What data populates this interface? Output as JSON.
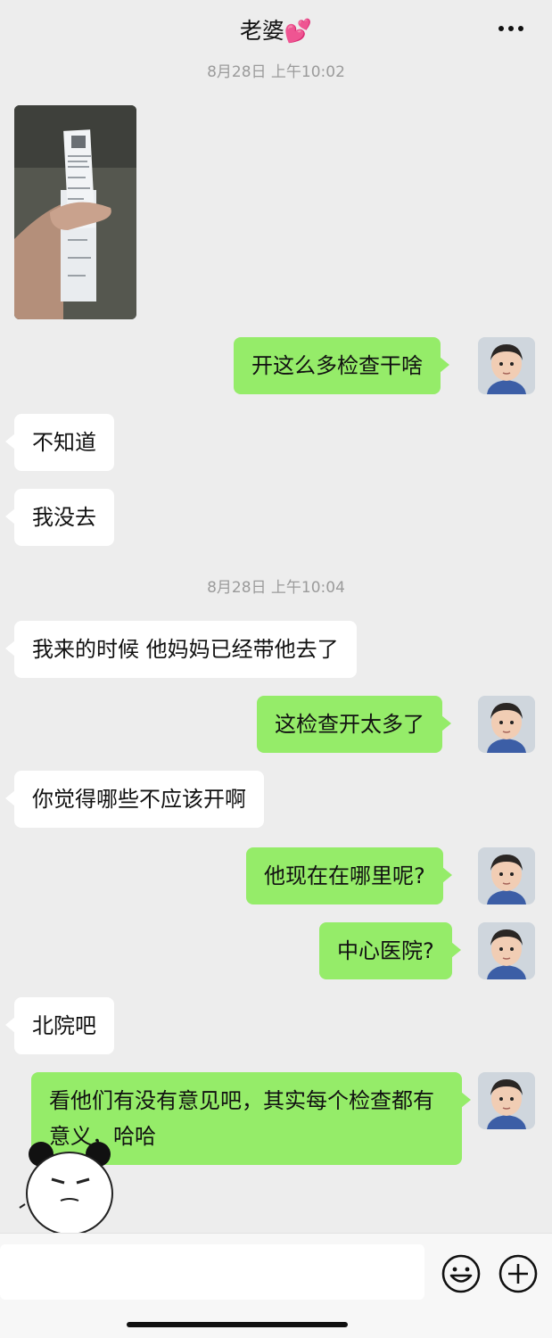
{
  "header": {
    "title": "老婆💕",
    "more_icon": "more-dots-icon"
  },
  "messages": {
    "time_1": "8月28日 上午10:02",
    "time_2": "8月28日 上午10:04",
    "m1": "开这么多检查干啥",
    "m2": "不知道",
    "m3": "我没去",
    "m4": "我来的时候 他妈妈已经带他去了",
    "m5": "这检查开太多了",
    "m6": "你觉得哪些不应该开啊",
    "m7": "他现在在哪里呢?",
    "m8": "中心医院?",
    "m9": "北院吧",
    "m10": "看他们有没有意见吧，其实每个检查都有意义，哈哈"
  },
  "input_bar": {
    "emoji_icon": "emoji-icon",
    "add_icon": "plus-circle-icon"
  },
  "colors": {
    "outgoing_bubble": "#95ec69",
    "incoming_bubble": "#ffffff",
    "background": "#ededed"
  }
}
